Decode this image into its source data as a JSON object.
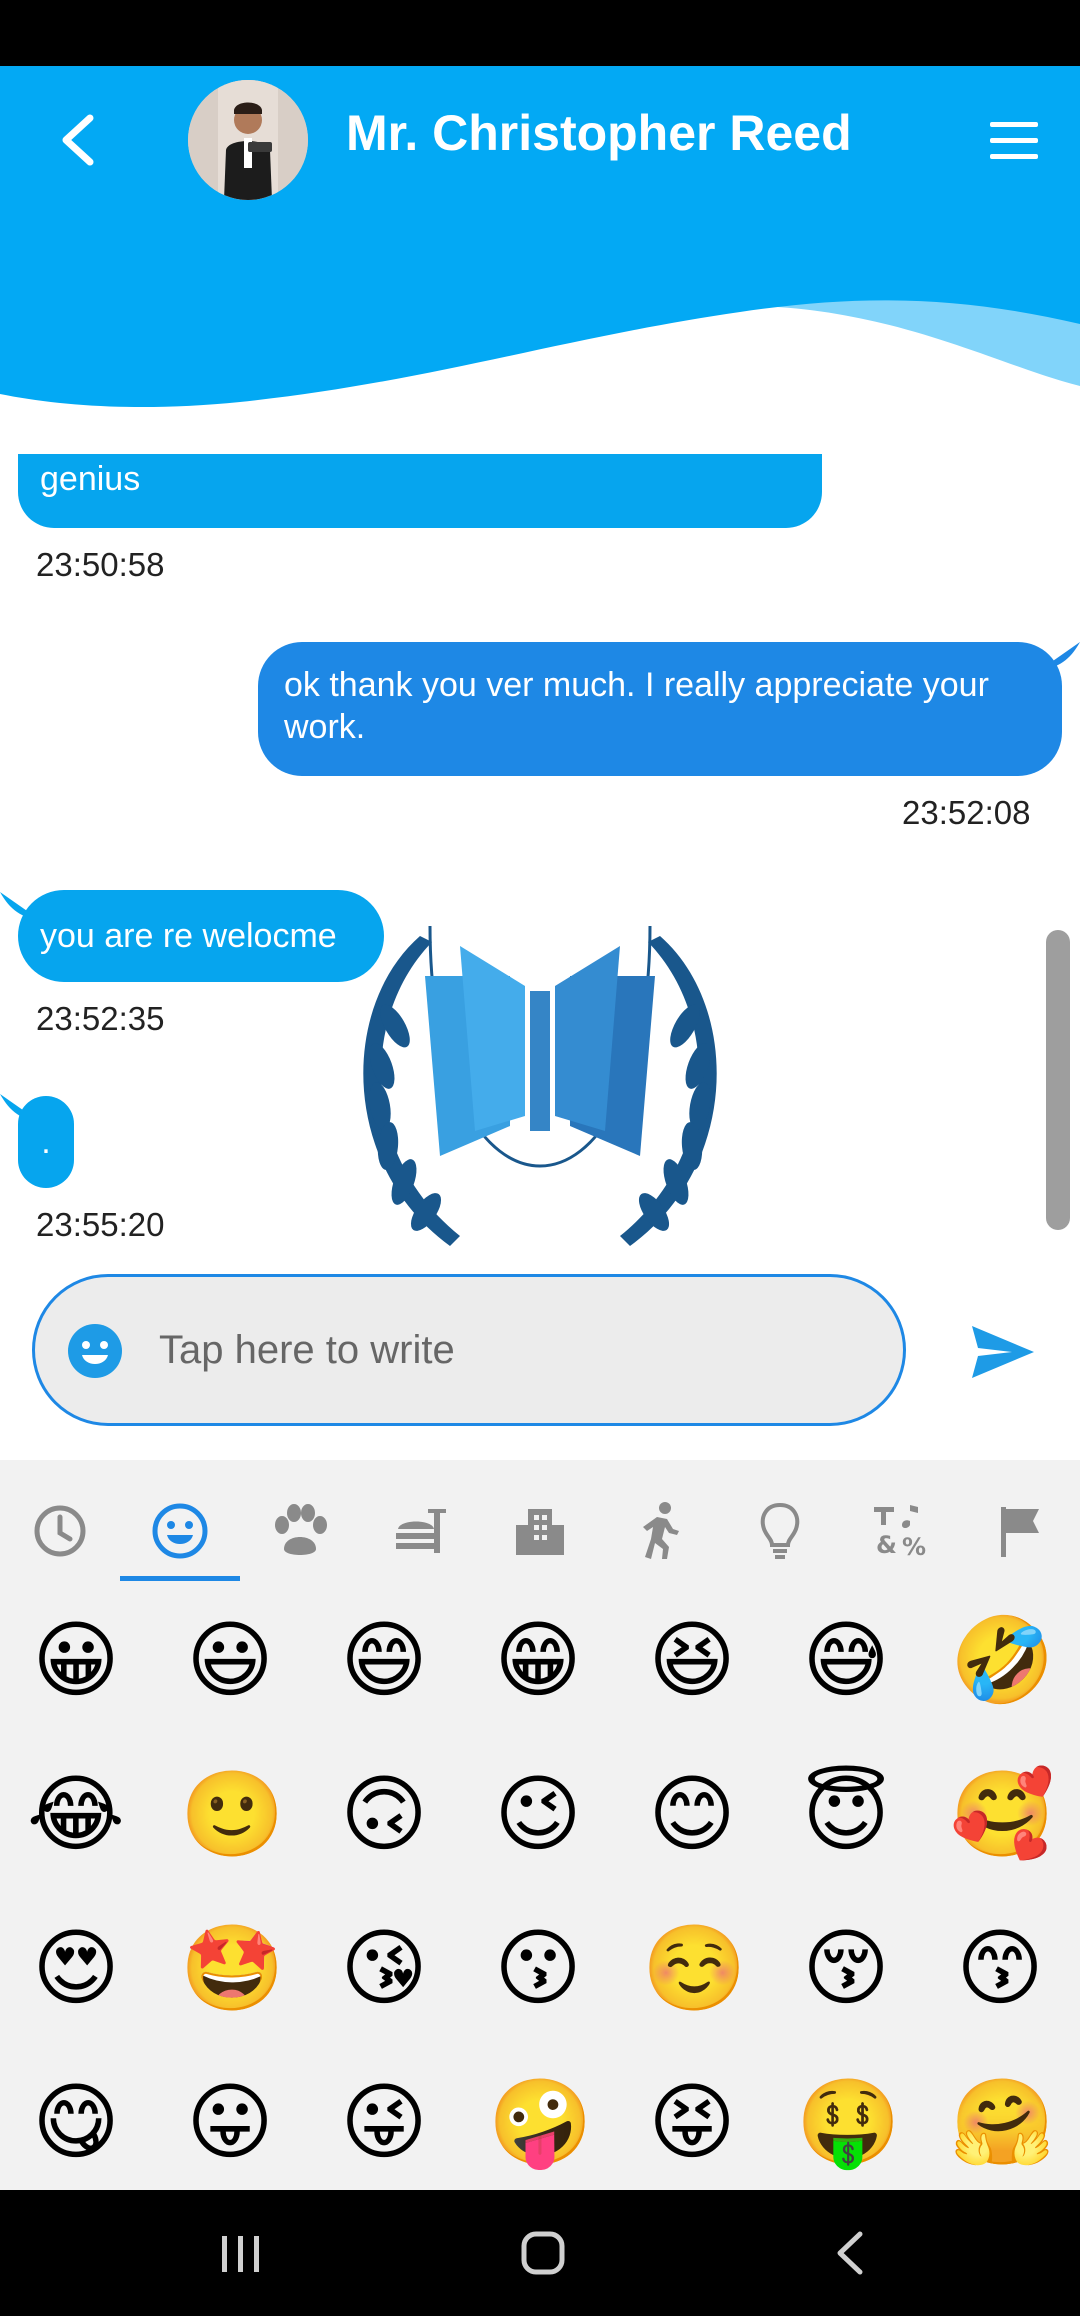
{
  "header": {
    "contact_name": "Mr. Christopher Reed",
    "color": "#03a9f4"
  },
  "messages": [
    {
      "direction": "in",
      "text": "genius",
      "time": "23:50:58"
    },
    {
      "direction": "out",
      "text": "ok thank you ver much. I really appreciate your work.",
      "time": "23:52:08"
    },
    {
      "direction": "in",
      "text": "you are re welocme",
      "time": "23:52:35"
    },
    {
      "direction": "in",
      "text": ".",
      "time": "23:55:20"
    }
  ],
  "composer": {
    "placeholder": "Tap here to write"
  },
  "emoji_panel": {
    "categories": [
      "recent-icon",
      "smileys-icon",
      "animals-icon",
      "food-icon",
      "places-icon",
      "activity-icon",
      "objects-icon",
      "symbols-icon",
      "flags-icon"
    ],
    "selected_category": "smileys-icon",
    "emojis": [
      [
        "😀",
        "😃",
        "😄",
        "😁",
        "😆",
        "😅",
        "🤣"
      ],
      [
        "😂",
        "🙂",
        "🙃",
        "😉",
        "😊",
        "😇",
        "🥰"
      ],
      [
        "😍",
        "🤩",
        "😘",
        "😗",
        "☺️",
        "😚",
        "😙"
      ],
      [
        "😋",
        "😛",
        "😜",
        "🤪",
        "😝",
        "🤑",
        "🤗"
      ]
    ]
  },
  "colors": {
    "incoming_bubble": "#06a5ee",
    "outgoing_bubble": "#1e88e5",
    "accent": "#1e88e5"
  }
}
